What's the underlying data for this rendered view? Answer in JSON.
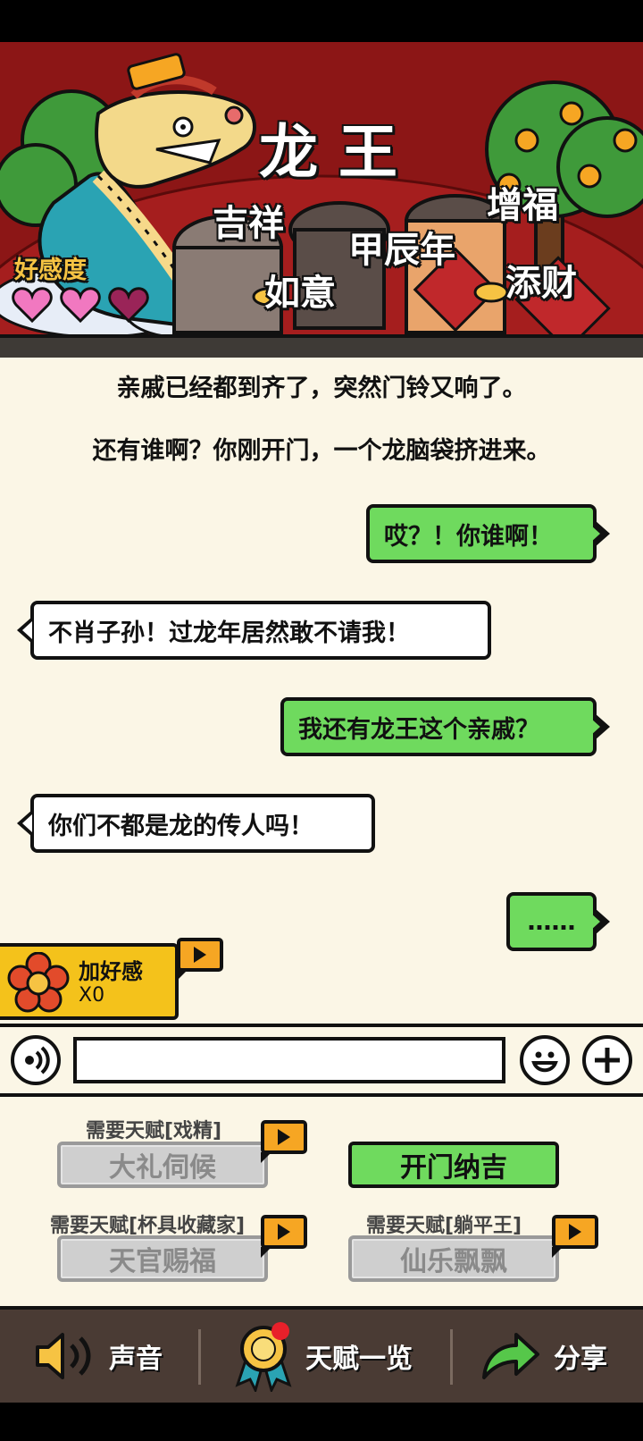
{
  "banner": {
    "title": "龙 王",
    "words": [
      "吉祥",
      "如意",
      "甲辰年",
      "增福",
      "添财"
    ],
    "favor_label": "好感度",
    "hearts_filled": 2,
    "hearts_total": 3
  },
  "chat": {
    "narration": [
      "亲戚已经都到齐了，突然门铃又响了。",
      "还有谁啊？你刚开门，一个龙脑袋挤进来。"
    ],
    "messages": [
      {
        "side": "right",
        "text": "哎？！你谁啊！"
      },
      {
        "side": "left",
        "text": "不肖子孙！过龙年居然敢不请我！"
      },
      {
        "side": "right",
        "text": "我还有龙王这个亲戚？"
      },
      {
        "side": "left",
        "text": "你们不都是龙的传人吗！"
      },
      {
        "side": "right",
        "text": "……"
      }
    ]
  },
  "favor_tag": {
    "label": "加好感",
    "count": "X0"
  },
  "options": [
    {
      "require": "需要天赋[戏精]",
      "label": "大礼伺候",
      "locked": true
    },
    {
      "require": "",
      "label": "开门纳吉",
      "locked": false
    },
    {
      "require": "需要天赋[杯具收藏家]",
      "label": "天官赐福",
      "locked": true
    },
    {
      "require": "需要天赋[躺平王]",
      "label": "仙乐飘飘",
      "locked": true
    }
  ],
  "nav": {
    "sound": "声音",
    "talents": "天赋一览",
    "share": "分享"
  },
  "colors": {
    "banner_red": "#8c1616",
    "bubble_green": "#6fda5e",
    "chat_bg": "#fbf6e6",
    "tag_yellow": "#f4c21b",
    "nav_brown": "#4a3b34"
  }
}
